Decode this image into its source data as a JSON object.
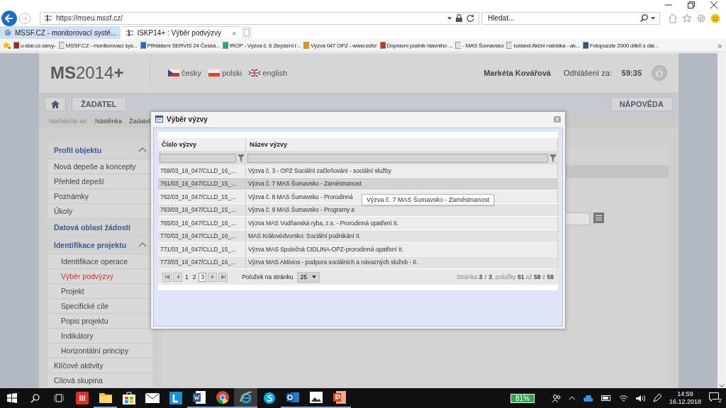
{
  "browser": {
    "address": "https://mseu.mssf.cz/",
    "search_placeholder": "Hledat...",
    "tabs": [
      {
        "label": "MSSF.CZ - monitorovací systé...",
        "selected": false
      },
      {
        "label": "ISKP14+ : Výběr podvýzvy",
        "selected": true,
        "close": "×"
      }
    ],
    "favorites": [
      "u-star.cz-slevy-",
      "MSSF.CZ - monitorovací sys...",
      "Přihlášení SERVIS 24  Česká...",
      "IROP - Výzva č. 6 Zlepšení ř...",
      "Výzva 047 OPZ - www.esfcr",
      "Dopravní podnik hlavního ...",
      "- MAS Šumavsko",
      "Iceland  Akční nabídka - ak...",
      "Fotopuzzle 2000 dílků s dár..."
    ],
    "more": "»"
  },
  "header": {
    "logo": "**MS**2014**+**",
    "languages": [
      {
        "label": "česky",
        "kind": "cz"
      },
      {
        "label": "polski",
        "kind": "pl"
      },
      {
        "label": "english",
        "kind": "en"
      }
    ],
    "user": "Markéta Kovářová",
    "logout_label": "Odhlášení za:",
    "logout_time": "59:35"
  },
  "nav": {
    "main": "ŽADATEL",
    "help": "NÁPOVĚDA"
  },
  "breadcrumb": {
    "label": "Nacházíte se:",
    "items": [
      "Nástěnka",
      "Žadatel"
    ]
  },
  "sidebar": [
    {
      "kind": "header",
      "label": "Profil objektu",
      "expanded": true
    },
    {
      "kind": "item",
      "label": "Nová depeše a koncepty",
      "selected": false
    },
    {
      "kind": "item",
      "label": "Přehled depeší",
      "selected": false
    },
    {
      "kind": "item",
      "label": "Poznámky",
      "selected": false
    },
    {
      "kind": "item",
      "label": "Úkoly",
      "selected": false
    },
    {
      "kind": "header",
      "label": "Datová oblast žádosti"
    },
    {
      "kind": "header",
      "label": "Identifikace projektu",
      "expanded": true
    },
    {
      "kind": "subitem",
      "label": "Identifikace operace",
      "selected": false
    },
    {
      "kind": "subitem",
      "label": "Výběr podvýzvy",
      "selected": true
    },
    {
      "kind": "subitem",
      "label": "Projekt",
      "selected": false
    },
    {
      "kind": "subitem",
      "label": "Specifické cíle",
      "selected": false
    },
    {
      "kind": "subitem",
      "label": "Popis projektu",
      "selected": false
    },
    {
      "kind": "subitem",
      "label": "Indikátory",
      "selected": false
    },
    {
      "kind": "subitem",
      "label": "Horizontální principy",
      "selected": false
    },
    {
      "kind": "item",
      "label": "Klíčové aktivity",
      "selected": false
    },
    {
      "kind": "item",
      "label": "Cílová skupina",
      "selected": false
    }
  ],
  "dialog": {
    "title": "Výběr výzvy",
    "columns": [
      "Číslo výzvy",
      "Název výzvy"
    ],
    "rows": [
      {
        "number": "759/03_16_047/CLLD_16_...",
        "name": "Výzva č. 3 - OPZ Sociální začleňování - sociální služby",
        "hovered": false
      },
      {
        "number": "761/03_16_047/CLLD_15_...",
        "name": "Výzva č. 7 MAS Šumavsko - Zaměstnanost",
        "hovered": true
      },
      {
        "number": "762/03_16_047/CLLD_15_...",
        "name": "Výzva č. 8 MAS Šumavsko - Prorodinná",
        "hovered": false
      },
      {
        "number": "763/03_16_047/CLLD_15_...",
        "name": "Výzva č. 9 MAS Šumavsko - Programy a",
        "hovered": false
      },
      {
        "number": "765/03_16_047/CLLD_16_...",
        "name": "Výzva MAS Vodňanská ryba, z.s. - Prorodinná opatření II.",
        "hovered": false
      },
      {
        "number": "770/03_16_047/CLLD_16_...",
        "name": "MAS Královédvorsko: Sociální podnikání II.",
        "hovered": false
      },
      {
        "number": "771/03_16_047/CLLD_15_...",
        "name": "Výzva MAS Společná CIDLINA-OPZ-prorodinná opatření II.",
        "hovered": false
      },
      {
        "number": "773/03_16_047/CLLD_16_...",
        "name": "Výzva MAS Aktivios - podpora sociálních a návazných služeb - II.",
        "hovered": false
      }
    ],
    "pages": [
      {
        "label": "1",
        "selected": false
      },
      {
        "label": "2",
        "selected": false
      },
      {
        "label": "3",
        "selected": true
      }
    ],
    "per_page_label": "Položek na stránku",
    "per_page": "25",
    "info": "Stránka **3** z **3**, položky **51** až **58** z **58**",
    "tooltip": "Výzva č. 7 MAS Šumavsko - Zaměstnanost"
  },
  "taskbar": {
    "apps": [
      {
        "kind": "red",
        "open": false,
        "selected": false
      },
      {
        "kind": "folder",
        "open": true,
        "selected": false
      },
      {
        "kind": "store",
        "open": false,
        "selected": false
      },
      {
        "kind": "mail",
        "open": false,
        "selected": false
      },
      {
        "kind": "blue",
        "open": false,
        "selected": false
      },
      {
        "kind": "word",
        "open": true,
        "selected": false
      },
      {
        "kind": "chrome",
        "open": true,
        "selected": false
      },
      {
        "kind": "ie",
        "open": true,
        "selected": true
      },
      {
        "kind": "skype",
        "open": false,
        "selected": false
      },
      {
        "kind": "outlook",
        "open": true,
        "selected": false
      },
      {
        "kind": "photos",
        "open": true,
        "selected": false
      },
      {
        "kind": "powerpoint",
        "open": true,
        "selected": false
      }
    ],
    "battery": "81%",
    "time": "14:59",
    "date": "16.12.2018",
    "notifications": "2"
  }
}
